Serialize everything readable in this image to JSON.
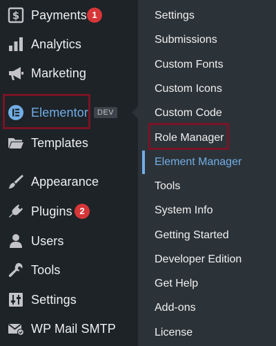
{
  "sidebar": {
    "items": [
      {
        "label": "Payments",
        "icon": "dollar-icon",
        "badge": "1"
      },
      {
        "label": "Analytics",
        "icon": "bar-chart-icon"
      },
      {
        "label": "Marketing",
        "icon": "megaphone-icon"
      },
      {
        "label": "Elementor",
        "icon": "elementor-icon",
        "tag": "DEV"
      },
      {
        "label": "Templates",
        "icon": "folder-icon"
      },
      {
        "label": "Appearance",
        "icon": "paintbrush-icon"
      },
      {
        "label": "Plugins",
        "icon": "plug-icon",
        "badge": "2"
      },
      {
        "label": "Users",
        "icon": "user-icon"
      },
      {
        "label": "Tools",
        "icon": "wrench-icon"
      },
      {
        "label": "Settings",
        "icon": "sliders-icon"
      },
      {
        "label": "WP Mail SMTP",
        "icon": "mail-icon"
      }
    ]
  },
  "submenu": {
    "items": [
      {
        "label": "Settings"
      },
      {
        "label": "Submissions"
      },
      {
        "label": "Custom Fonts"
      },
      {
        "label": "Custom Icons"
      },
      {
        "label": "Custom Code"
      },
      {
        "label": "Role Manager"
      },
      {
        "label": "Element Manager"
      },
      {
        "label": "Tools"
      },
      {
        "label": "System Info"
      },
      {
        "label": "Getting Started"
      },
      {
        "label": "Developer Edition"
      },
      {
        "label": "Get Help"
      },
      {
        "label": "Add-ons"
      },
      {
        "label": "License"
      }
    ]
  },
  "colors": {
    "sidebar_bg": "#1d2327",
    "submenu_bg": "#2c3338",
    "text": "#f0f0f1",
    "accent": "#72aee6",
    "badge": "#d63638",
    "highlight_border": "#7a1326"
  }
}
